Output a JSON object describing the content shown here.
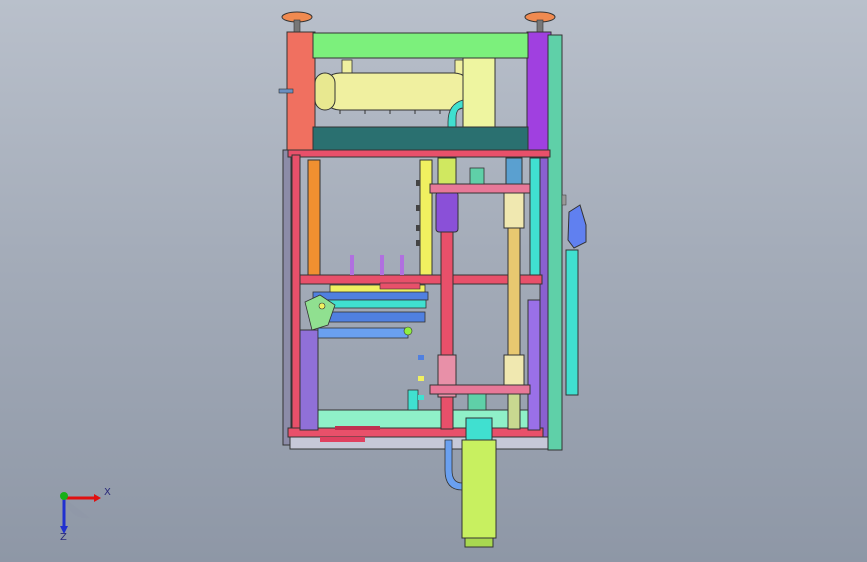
{
  "viewport": {
    "background_top": "#b9c0cb",
    "background_bottom": "#8e97a6"
  },
  "triad": {
    "x_label": "X",
    "z_label": "Z",
    "colors": {
      "x": "#e01010",
      "y": "#18b018",
      "z": "#2030d0"
    }
  },
  "model": {
    "palette": {
      "frame_red": "#e8506a",
      "frame_green": "#7cf07c",
      "frame_purple": "#a040e0",
      "frame_salmon": "#f07060",
      "tank_yellow": "#f0f0a0",
      "cyan": "#40e0d0",
      "teal": "#2a7070",
      "blue": "#5080e0",
      "orange": "#f09030"
    },
    "handwheels": [
      "left-handwheel",
      "right-handwheel"
    ]
  }
}
